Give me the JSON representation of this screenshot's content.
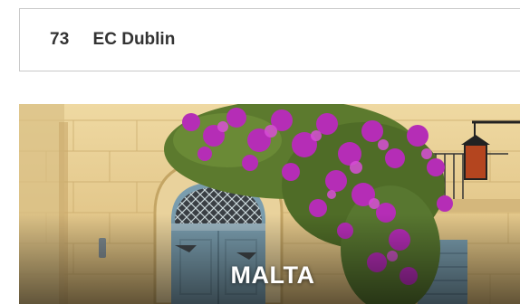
{
  "list_item": {
    "rank": "73",
    "name": "EC Dublin"
  },
  "destination_card": {
    "title": "MALTA"
  },
  "colors": {
    "wall": "#e6cc8e",
    "door": "#7a9dae",
    "flowers": "#b02bb0",
    "text": "#333333"
  }
}
